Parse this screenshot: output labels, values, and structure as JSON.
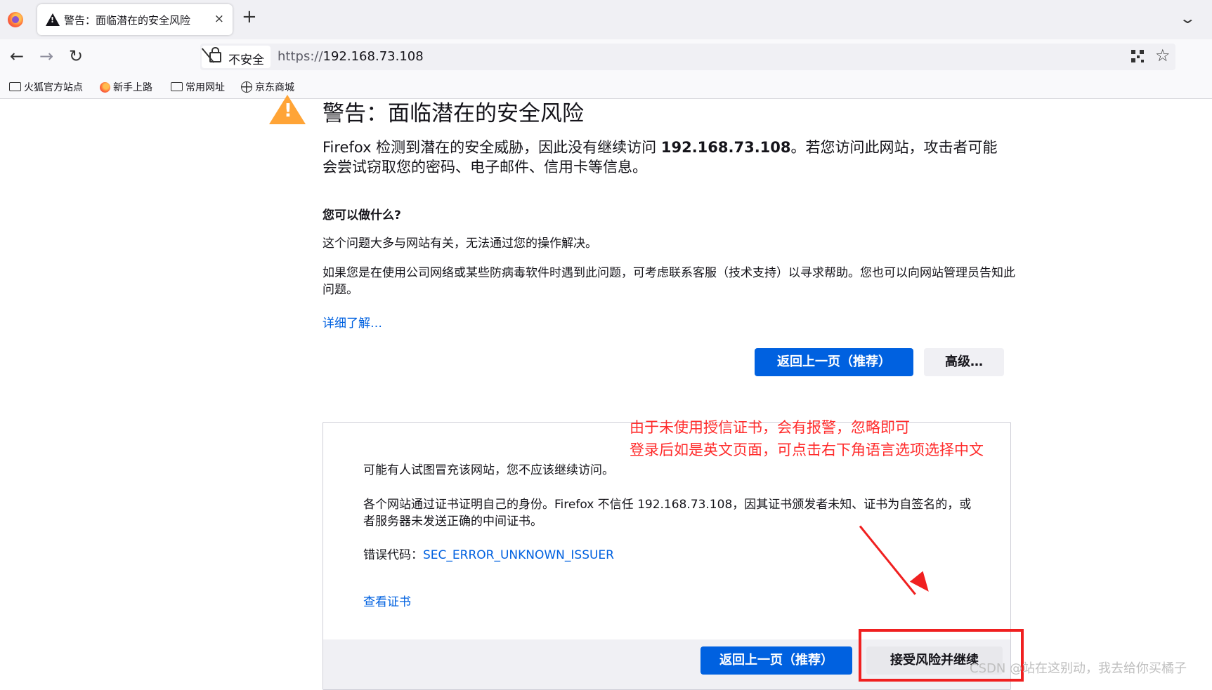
{
  "tab": {
    "title": "警告：面临潜在的安全风险",
    "close": "×",
    "new_tab": "+",
    "list": "⌄"
  },
  "nav": {
    "back": "←",
    "forward": "→",
    "reload": "↻",
    "insecure_label": "不安全",
    "url_scheme": "https://",
    "url_host": "192.168.73.108",
    "star": "☆"
  },
  "bookmarks": [
    "火狐官方站点",
    "新手上路",
    "常用网址",
    "京东商城"
  ],
  "page": {
    "heading": "警告：面临潜在的安全风险",
    "intro_pre": "Firefox 检测到潜在的安全威胁，因此没有继续访问 ",
    "intro_host": "192.168.73.108",
    "intro_post": "。若您访问此网站，攻击者可能会尝试窃取您的密码、电子邮件、信用卡等信息。",
    "what_heading": "您可以做什么?",
    "what_p1": "这个问题大多与网站有关，无法通过您的操作解决。",
    "what_p2": "如果您是在使用公司网络或某些防病毒软件时遇到此问题，可考虑联系客服（技术支持）以寻求帮助。您也可以向网站管理员告知此问题。",
    "learn_more": "详细了解…",
    "go_back": "返回上一页（推荐）",
    "advanced": "高级…"
  },
  "advanced_panel": {
    "p1": "可能有人试图冒充该网站，您不应该继续访问。",
    "p2": "各个网站通过证书证明自己的身份。Firefox 不信任 192.168.73.108，因其证书颁发者未知、证书为自签名的，或者服务器未发送正确的中间证书。",
    "error_label": "错误代码：",
    "error_code": "SEC_ERROR_UNKNOWN_ISSUER",
    "view_cert": "查看证书",
    "go_back": "返回上一页（推荐）",
    "accept": "接受风险并继续"
  },
  "annotation": {
    "line1": "由于未使用授信证书，会有报警，忽略即可",
    "line2": "登录后如是英文页面，可点击右下角语言选项选择中文"
  },
  "watermark": "CSDN @站在这别动，我去给你买橘子"
}
